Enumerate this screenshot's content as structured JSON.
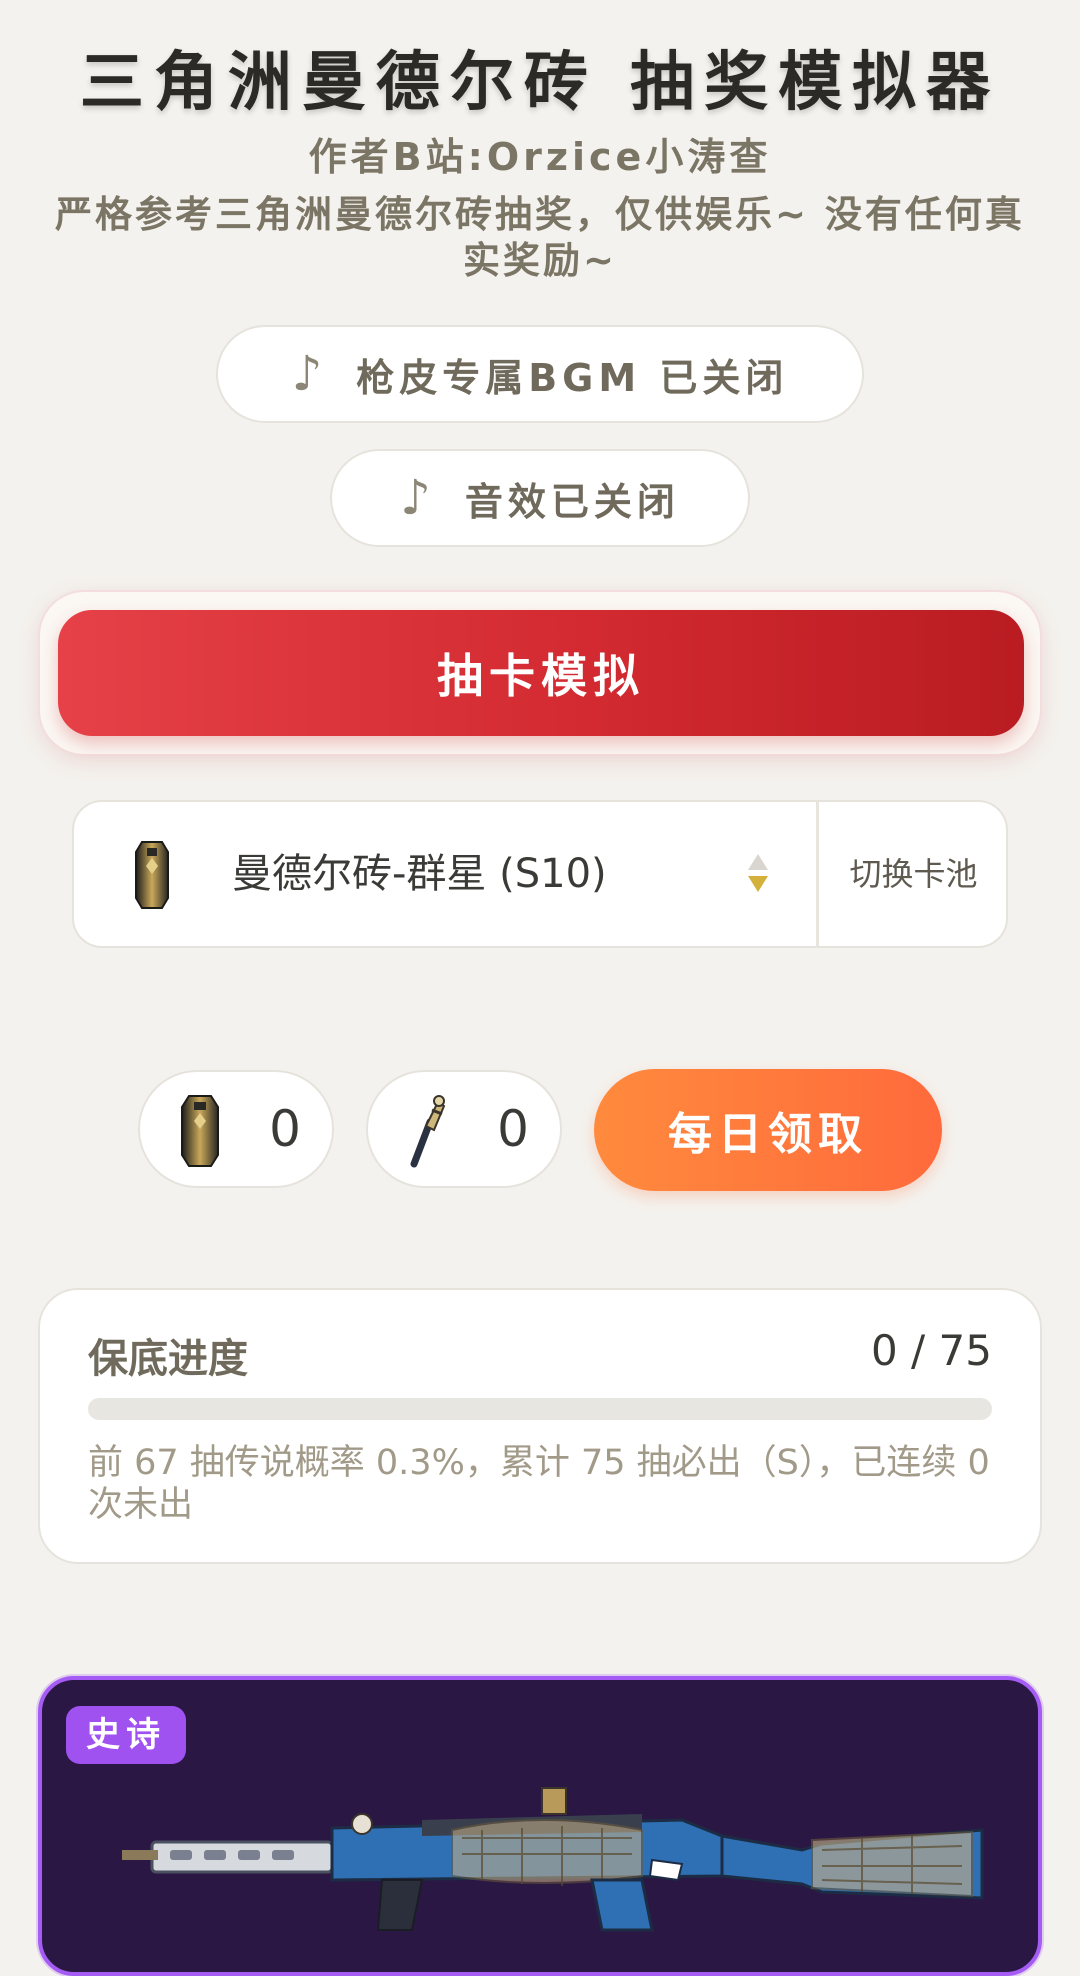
{
  "header": {
    "title": "三角洲曼德尔砖 抽奖模拟器",
    "author": "作者B站:Orzice小涛查",
    "description": "严格参考三角洲曼德尔砖抽奖，仅供娱乐~ 没有任何真实奖励~"
  },
  "toggles": {
    "bgm_label": "枪皮专属BGM 已关闭",
    "sfx_label": "音效已关闭",
    "note_glyph": "♪"
  },
  "draw": {
    "button_label": "抽卡模拟"
  },
  "pool": {
    "selected": "曼德尔砖-群星 (S10)",
    "switch_label": "切换卡池",
    "accent": "#d4b13a"
  },
  "inventory": {
    "brick_count": "0",
    "key_count": "0",
    "daily_label": "每日领取"
  },
  "pity": {
    "label": "保底进度",
    "value": "0 / 75",
    "progress": 0,
    "note": "前 67 抽传说概率 0.3%，累计 75 抽必出（S），已连续 0 次未出"
  },
  "result": {
    "rarity": "史诗",
    "rarity_color": "#a052f0"
  }
}
